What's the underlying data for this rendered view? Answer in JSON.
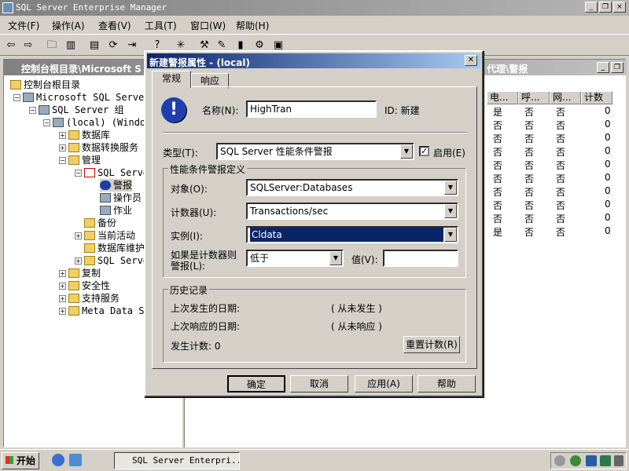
{
  "app": {
    "title": "SQL Server Enterprise Manager"
  },
  "menu": [
    "文件(F)",
    "操作(A)",
    "查看(V)",
    "工具(T)",
    "窗口(W)",
    "帮助(H)"
  ],
  "console": {
    "title_left": "控制台根目录\\Microsoft S",
    "title_right": "代理\\警报"
  },
  "tree": {
    "root": "控制台根目录",
    "servers": "Microsoft SQL Servers",
    "group": "SQL Server 组",
    "local": "(local) (Windows",
    "items": [
      "数据库",
      "数据转换服务",
      "管理",
      "SQL Server",
      "警报",
      "操作员",
      "作业",
      "备份",
      "当前活动",
      "数据库维护",
      "SQL Server",
      "复制",
      "安全性",
      "支持服务",
      "Meta Data Ser"
    ]
  },
  "list": {
    "headers": [
      "电...",
      "呼...",
      "网...",
      "计数"
    ],
    "rows": [
      [
        "是",
        "否",
        "否",
        "0"
      ],
      [
        "否",
        "否",
        "否",
        "0"
      ],
      [
        "否",
        "否",
        "否",
        "0"
      ],
      [
        "否",
        "否",
        "否",
        "0"
      ],
      [
        "否",
        "否",
        "否",
        "0"
      ],
      [
        "否",
        "否",
        "否",
        "0"
      ],
      [
        "否",
        "否",
        "否",
        "0"
      ],
      [
        "否",
        "否",
        "否",
        "0"
      ],
      [
        "否",
        "否",
        "否",
        "0"
      ],
      [
        "是",
        "否",
        "否",
        "0"
      ]
    ]
  },
  "dialog": {
    "title": "新建警报属性 - (local)",
    "tabs": [
      "常规",
      "响应"
    ],
    "name_label": "名称(N):",
    "name_value": "HighTran",
    "id_text": "ID: 新建",
    "type_label": "类型(T):",
    "type_value": "SQL Server 性能条件警报",
    "enable_label": "启用(E)",
    "perf_group": "性能条件警报定义",
    "object_label": "对象(O):",
    "object_value": "SQLServer:Databases",
    "counter_label": "计数器(U):",
    "counter_value": "Transactions/sec",
    "instance_label": "实例(I):",
    "instance_value": "Cldata",
    "cond_label_1": "如果是计数器则",
    "cond_label_2": "警报(L):",
    "cond_value": "低于",
    "value_label": "值(V):",
    "value_value": "",
    "history_group": "历史记录",
    "last_occurred_label": "上次发生的日期:",
    "last_occurred_value": "( 从未发生 )",
    "last_response_label": "上次响应的日期:",
    "last_response_value": "( 从未响应 )",
    "count_label": "发生计数: 0",
    "reset_button": "重置计数(R)",
    "ok_button": "确定",
    "cancel_button": "取消",
    "apply_button": "应用(A)",
    "help_button": "帮助"
  },
  "taskbar": {
    "start": "开始",
    "task": "SQL Server Enterpri..."
  }
}
